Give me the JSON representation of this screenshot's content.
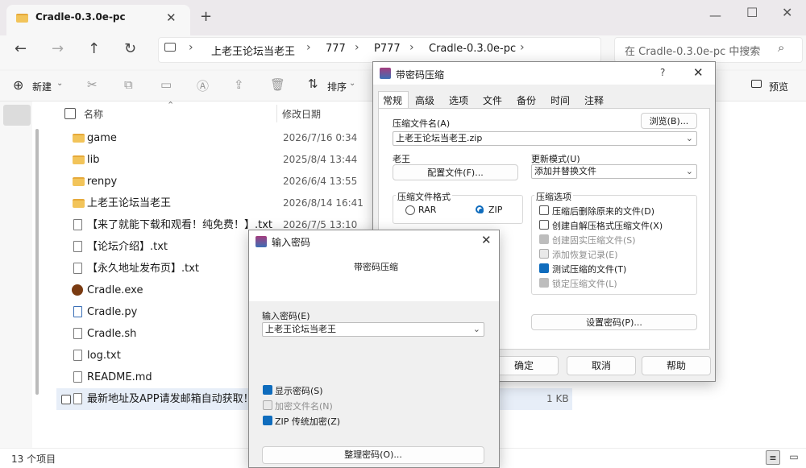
{
  "explorer": {
    "tab_title": "Cradle-0.3.0e-pc",
    "breadcrumbs": [
      "上老王论坛当老王",
      "777",
      "P777",
      "Cradle-0.3.0e-pc"
    ],
    "search_placeholder": "在 Cradle-0.3.0e-pc 中搜索",
    "toolbar": {
      "new_label": "新建",
      "sort_label": "排序",
      "preview_label": "预览"
    },
    "columns": {
      "name": "名称",
      "modified": "修改日期"
    },
    "files": [
      {
        "name": "game",
        "date": "2026/7/16 0:34",
        "icon": "folder-icon"
      },
      {
        "name": "lib",
        "date": "2025/8/4 13:44",
        "icon": "folder-icon"
      },
      {
        "name": "renpy",
        "date": "2026/6/4 13:55",
        "icon": "folder-icon"
      },
      {
        "name": "上老王论坛当老王",
        "date": "2026/8/14 16:41",
        "icon": "folder-icon"
      },
      {
        "name": "【来了就能下载和观看！纯免费！】.txt",
        "date": "2026/7/5 13:10",
        "icon": "text-file-icon"
      },
      {
        "name": "【论坛介绍】.txt",
        "date": "",
        "icon": "text-file-icon"
      },
      {
        "name": "【永久地址发布页】.txt",
        "date": "",
        "icon": "text-file-icon"
      },
      {
        "name": "Cradle.exe",
        "date": "",
        "icon": "app-icon"
      },
      {
        "name": "Cradle.py",
        "date": "",
        "icon": "python-file-icon"
      },
      {
        "name": "Cradle.sh",
        "date": "",
        "icon": "file-icon"
      },
      {
        "name": "log.txt",
        "date": "",
        "icon": "text-file-icon"
      },
      {
        "name": "README.md",
        "date": "",
        "icon": "markdown-file-icon"
      },
      {
        "name": "最新地址及APP请发邮箱自动获取！！！",
        "date": "",
        "icon": "text-file-icon",
        "size": "1 KB"
      }
    ],
    "status_count": "13 个项目"
  },
  "archive_dialog": {
    "title": "带密码压缩",
    "help_glyph": "?",
    "tabs": [
      "常规",
      "高级",
      "选项",
      "文件",
      "备份",
      "时间",
      "注释"
    ],
    "archive_name_label": "压缩文件名(A)",
    "browse_label": "浏览(B)...",
    "archive_name_value": "上老王论坛当老王.zip",
    "profile_label": "老王",
    "profile_button": "配置文件(F)...",
    "update_mode_label": "更新模式(U)",
    "update_mode_value": "添加并替换文件",
    "format_label": "压缩文件格式",
    "format_rar": "RAR",
    "format_zip": "ZIP",
    "options_label": "压缩选项",
    "options": [
      {
        "label": "压缩后删除原来的文件(D)",
        "checked": false,
        "disabled": false
      },
      {
        "label": "创建自解压格式压缩文件(X)",
        "checked": false,
        "disabled": false
      },
      {
        "label": "创建固实压缩文件(S)",
        "checked": true,
        "disabled": true
      },
      {
        "label": "添加恢复记录(E)",
        "checked": false,
        "disabled": true
      },
      {
        "label": "测试压缩的文件(T)",
        "checked": true,
        "disabled": false
      },
      {
        "label": "锁定压缩文件(L)",
        "checked": true,
        "disabled": true
      }
    ],
    "set_password_button": "设置密码(P)...",
    "ok_button": "确定",
    "cancel_button": "取消",
    "help_button": "帮助"
  },
  "password_dialog": {
    "title": "输入密码",
    "subtitle": "带密码压缩",
    "password_label": "输入密码(E)",
    "password_value": "上老王论坛当老王",
    "show_password": "显示密码(S)",
    "encrypt_names": "加密文件名(N)",
    "zip_legacy": "ZIP 传统加密(Z)",
    "organize_button": "整理密码(O)..."
  }
}
